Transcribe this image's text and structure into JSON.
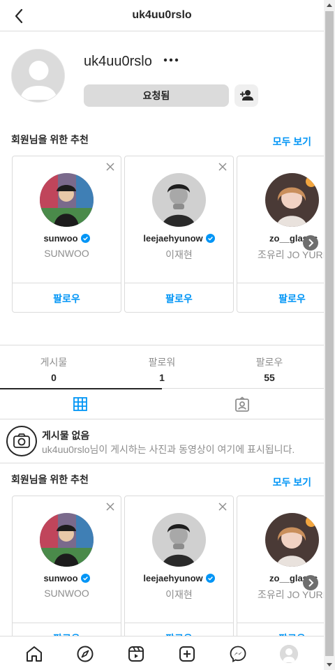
{
  "header": {
    "title": "uk4uu0rslo"
  },
  "profile": {
    "username": "uk4uu0rslo",
    "requested_label": "요청됨"
  },
  "suggestions_top": {
    "heading": "회원님을 위한 추천",
    "see_all": "모두 보기",
    "cards": [
      {
        "handle": "sunwoo",
        "name": "SUNWOO",
        "follow": "팔로우",
        "verified": true
      },
      {
        "handle": "leejaehyunow",
        "name": "이재현",
        "follow": "팔로우",
        "verified": true
      },
      {
        "handle": "zo__glasss",
        "name": "조유리 JO YURI",
        "follow": "팔로우",
        "verified": false
      }
    ]
  },
  "stats": {
    "posts_label": "게시물",
    "posts_count": "0",
    "followers_label": "팔로워",
    "followers_count": "1",
    "following_label": "팔로우",
    "following_count": "55"
  },
  "empty": {
    "title": "게시물 없음",
    "description": "uk4uu0rslo님이 게시하는 사진과 동영상이 여기에 표시됩니다."
  },
  "suggestions_bottom": {
    "heading": "회원님을 위한 추천",
    "see_all": "모두 보기",
    "cards": [
      {
        "handle": "sunwoo",
        "name": "SUNWOO",
        "follow": "팔로우",
        "verified": true
      },
      {
        "handle": "leejaehyunow",
        "name": "이재현",
        "follow": "팔로우",
        "verified": true
      },
      {
        "handle": "zo__glasss",
        "name": "조유리 JO YURI",
        "follow": "팔로우",
        "verified": false
      }
    ]
  },
  "colors": {
    "accent": "#0095f6",
    "text": "#262626",
    "muted": "#8e8e8e",
    "border": "#dbdbdb"
  }
}
